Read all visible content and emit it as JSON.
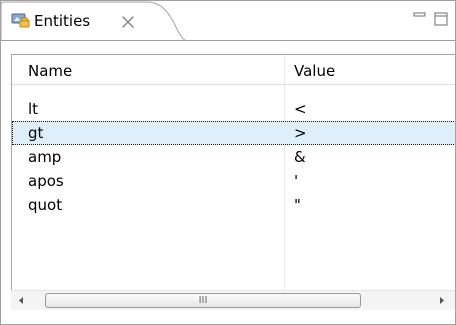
{
  "view": {
    "tab_title": "Entities",
    "tab_icon": "entities-icon",
    "close_icon": "close-icon",
    "minimize_icon": "minimize-icon",
    "maximize_icon": "maximize-icon"
  },
  "table": {
    "columns": [
      "Name",
      "Value"
    ],
    "rows": [
      {
        "name": "lt",
        "value": "<",
        "selected": false
      },
      {
        "name": "gt",
        "value": ">",
        "selected": true
      },
      {
        "name": "amp",
        "value": "&",
        "selected": false
      },
      {
        "name": "apos",
        "value": "'",
        "selected": false
      },
      {
        "name": "quot",
        "value": "\"",
        "selected": false
      }
    ]
  },
  "scrollbar": {
    "grip_label": "III",
    "left_arrow": "left-arrow-icon",
    "right_arrow": "right-arrow-icon"
  },
  "colors": {
    "selection": "#dfeefb",
    "border": "#a0a0a0"
  }
}
